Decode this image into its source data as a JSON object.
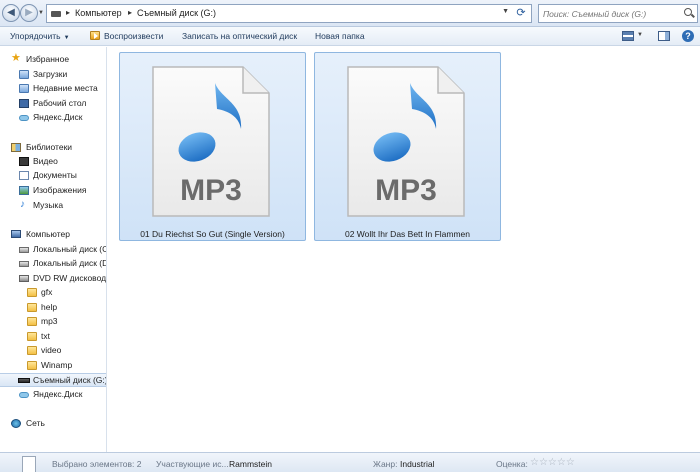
{
  "address": {
    "breadcrumbs": [
      "Компьютер",
      "Съемный диск (G:)"
    ],
    "search_placeholder": "Поиск: Съемный диск (G:)"
  },
  "toolbar": {
    "organize_label": "Упорядочить",
    "play_label": "Воспроизвести",
    "burn_label": "Записать на оптический диск",
    "new_folder_label": "Новая папка"
  },
  "sidebar": {
    "items": [
      {
        "label": "Избранное",
        "icon": "star-icon"
      },
      {
        "label": "Загрузки",
        "icon": "downloads-folder-icon"
      },
      {
        "label": "Недавние места",
        "icon": "recent-places-icon"
      },
      {
        "label": "Рабочий стол",
        "icon": "desktop-icon"
      },
      {
        "label": "Яндекс.Диск",
        "icon": "yandex-disk-icon"
      },
      {
        "label": "Библиотеки",
        "icon": "libraries-icon"
      },
      {
        "label": "Видео",
        "icon": "video-library-icon"
      },
      {
        "label": "Документы",
        "icon": "documents-library-icon"
      },
      {
        "label": "Изображения",
        "icon": "images-library-icon"
      },
      {
        "label": "Музыка",
        "icon": "music-library-icon"
      },
      {
        "label": "Компьютер",
        "icon": "computer-icon"
      },
      {
        "label": "Локальный диск (С",
        "icon": "local-disk-icon"
      },
      {
        "label": "Локальный диск (D",
        "icon": "local-disk-icon"
      },
      {
        "label": "DVD RW дисковод (",
        "icon": "dvd-drive-icon"
      },
      {
        "label": "gfx",
        "icon": "folder-icon"
      },
      {
        "label": "help",
        "icon": "folder-icon"
      },
      {
        "label": "mp3",
        "icon": "folder-icon"
      },
      {
        "label": "txt",
        "icon": "folder-icon"
      },
      {
        "label": "video",
        "icon": "folder-icon"
      },
      {
        "label": "Winamp",
        "icon": "folder-icon"
      },
      {
        "label": "Съемный диск (G:)",
        "icon": "removable-disk-icon"
      },
      {
        "label": "Яндекс.Диск",
        "icon": "yandex-disk-icon"
      },
      {
        "label": "Сеть",
        "icon": "network-icon"
      }
    ]
  },
  "files": [
    {
      "name": "01 Du Riechst So Gut (Single Version)",
      "type_label": "MP3"
    },
    {
      "name": "02 Wollt Ihr Das Bett In Flammen",
      "type_label": "MP3"
    }
  ],
  "status": {
    "selected_label": "Выбрано элементов: 2",
    "artist_key": "Участвующие ис...",
    "artist_value": "Rammstein",
    "genre_key": "Жанр:",
    "genre_value": "Industrial",
    "rating_key": "Оценка:",
    "rating_stars": "☆☆☆☆☆"
  },
  "colors": {
    "selection_bg": "#cfe2f7",
    "selection_border": "#8fb7e0",
    "note_blue": "#2b7fd4"
  }
}
